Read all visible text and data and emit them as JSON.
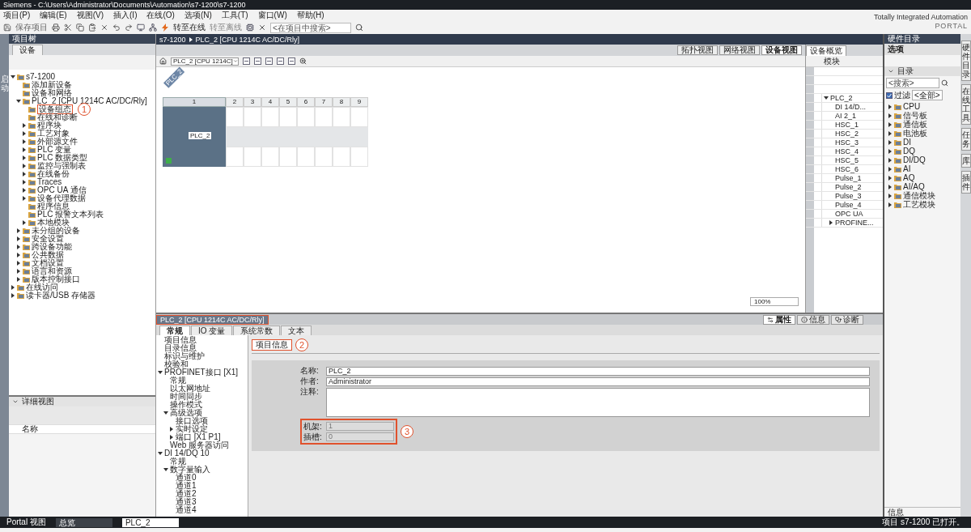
{
  "window": {
    "title": "Siemens - C:\\Users\\Administrator\\Documents\\Automation\\s7-1200\\s7-1200"
  },
  "brand": {
    "line1": "Totally Integrated Automation",
    "line2": "PORTAL"
  },
  "menu": [
    "项目(P)",
    "编辑(E)",
    "视图(V)",
    "插入(I)",
    "在线(O)",
    "选项(N)",
    "工具(T)",
    "窗口(W)",
    "帮助(H)"
  ],
  "toolbar": {
    "save": "保存项目",
    "go_online": "转至在线",
    "go_offline": "转至离线",
    "search": {
      "placeholder": "<在项目中搜索>"
    }
  },
  "side_strip": {
    "label": "启动"
  },
  "project_tree": {
    "title": "项目树",
    "tab": "设备",
    "items": [
      {
        "label": "s7-1200",
        "expanded": true,
        "children": [
          {
            "label": "添加新设备"
          },
          {
            "label": "设备和网络"
          },
          {
            "label": "PLC_2 [CPU 1214C AC/DC/Rly]",
            "expanded": true,
            "children": [
              {
                "label": "设备组态",
                "callout": "1"
              },
              {
                "label": "在线和诊断"
              },
              {
                "label": "程序块",
                "expanded": false
              },
              {
                "label": "工艺对象",
                "expanded": false
              },
              {
                "label": "外部源文件",
                "expanded": false
              },
              {
                "label": "PLC 变量",
                "expanded": false
              },
              {
                "label": "PLC 数据类型",
                "expanded": false
              },
              {
                "label": "监控与强制表",
                "expanded": false
              },
              {
                "label": "在线备份",
                "expanded": false
              },
              {
                "label": "Traces",
                "expanded": false
              },
              {
                "label": "OPC UA 通信",
                "expanded": false
              },
              {
                "label": "设备代理数据",
                "expanded": false
              },
              {
                "label": "程序信息"
              },
              {
                "label": "PLC 报警文本列表"
              },
              {
                "label": "本地模块",
                "expanded": false
              }
            ]
          },
          {
            "label": "未分组的设备",
            "expanded": false
          },
          {
            "label": "安全设置",
            "expanded": false
          },
          {
            "label": "跨设备功能",
            "expanded": false
          },
          {
            "label": "公共数据",
            "expanded": false
          },
          {
            "label": "文档设置",
            "expanded": false
          },
          {
            "label": "语言和资源",
            "expanded": false
          },
          {
            "label": "版本控制接口",
            "expanded": false
          }
        ]
      },
      {
        "label": "在线访问",
        "expanded": false
      },
      {
        "label": "读卡器/USB 存储器",
        "expanded": false
      }
    ]
  },
  "details_view": {
    "title": "详细视图",
    "column": "名称"
  },
  "editor": {
    "breadcrumb": [
      "s7-1200",
      "PLC_2 [CPU 1214C AC/DC/Rly]"
    ],
    "view_tabs": [
      {
        "label": "拓扑视图",
        "selected": false
      },
      {
        "label": "网络视图",
        "selected": false
      },
      {
        "label": "设备视图",
        "selected": true
      }
    ],
    "device_select": "PLC_2 [CPU 1214C]",
    "rack_label": "PLC_2",
    "slots": [
      "1",
      "2",
      "3",
      "4",
      "5",
      "6",
      "7",
      "8",
      "9"
    ],
    "cpu_label": "PLC_2",
    "zoom": "100%"
  },
  "device_overview": {
    "tab": "设备概览",
    "column": "模块",
    "rows": [
      {
        "module": "PLC_2",
        "expanded": true,
        "children": [
          {
            "module": "DI 14/D..."
          },
          {
            "module": "AI 2_1"
          },
          {
            "module": "HSC_1"
          },
          {
            "module": "HSC_2"
          },
          {
            "module": "HSC_3"
          },
          {
            "module": "HSC_4"
          },
          {
            "module": "HSC_5"
          },
          {
            "module": "HSC_6"
          },
          {
            "module": "Pulse_1"
          },
          {
            "module": "Pulse_2"
          },
          {
            "module": "Pulse_3"
          },
          {
            "module": "Pulse_4"
          },
          {
            "module": "OPC UA"
          },
          {
            "module": "PROFINE...",
            "expanded": false
          }
        ]
      }
    ]
  },
  "inspector": {
    "title": "PLC_2 [CPU 1214C AC/DC/Rly]",
    "title_marked": true,
    "tabs": [
      {
        "label": "常规",
        "selected": true
      },
      {
        "label": "IO 变量",
        "selected": false
      },
      {
        "label": "系统常数",
        "selected": false
      },
      {
        "label": "文本",
        "selected": false
      }
    ],
    "panel_tabs": [
      {
        "label": "属性",
        "selected": true
      },
      {
        "label": "信息",
        "selected": false
      },
      {
        "label": "诊断",
        "selected": false
      }
    ],
    "nav": [
      {
        "label": "项目信息"
      },
      {
        "label": "目录信息"
      },
      {
        "label": "标识与维护"
      },
      {
        "label": "校验和"
      },
      {
        "label": "PROFINET接口 [X1]",
        "expanded": true,
        "children": [
          {
            "label": "常规"
          },
          {
            "label": "以太网地址"
          },
          {
            "label": "时间同步"
          },
          {
            "label": "操作模式"
          },
          {
            "label": "高级选项",
            "expanded": true,
            "children": [
              {
                "label": "接口选项"
              },
              {
                "label": "实时设定",
                "expanded": false
              },
              {
                "label": "端口 [X1 P1]",
                "expanded": false
              }
            ]
          },
          {
            "label": "Web 服务器访问"
          }
        ]
      },
      {
        "label": "DI 14/DQ 10",
        "expanded": true,
        "children": [
          {
            "label": "常规"
          },
          {
            "label": "数字量输入",
            "expanded": true,
            "children": [
              {
                "label": "通道0"
              },
              {
                "label": "通道1"
              },
              {
                "label": "通道2"
              },
              {
                "label": "通道3"
              },
              {
                "label": "通道4"
              }
            ]
          }
        ]
      }
    ],
    "section": {
      "label": "项目信息",
      "callout": "2"
    },
    "fields": [
      {
        "kind": "text",
        "label": "名称:",
        "value": "PLC_2",
        "disabled": false
      },
      {
        "kind": "text",
        "label": "作者:",
        "value": "Administrator",
        "disabled": false
      },
      {
        "kind": "area",
        "label": "注释:",
        "disabled": false
      },
      {
        "kind": "readonly",
        "label": "机架:",
        "value": "1",
        "disabled": true
      },
      {
        "kind": "readonly",
        "label": "插槽:",
        "value": "0",
        "disabled": true
      }
    ],
    "readonly_callout": "3"
  },
  "catalog": {
    "title": "硬件目录",
    "options": "选项",
    "section": "目录",
    "search": {
      "placeholder": "<搜索>"
    },
    "filter": {
      "label": "过滤",
      "value": "<全部>",
      "checked": true
    },
    "items": [
      "CPU",
      "信号板",
      "通信板",
      "电池板",
      "DI",
      "DQ",
      "DI/DQ",
      "AI",
      "AQ",
      "AI/AQ",
      "通信模块",
      "工艺模块"
    ],
    "info": "信息"
  },
  "side_tabs": [
    "硬件目录",
    "在线工具",
    "任务",
    "库",
    "插件"
  ],
  "taskbar": {
    "portal": "Portal 视图",
    "items": [
      {
        "label": "总览",
        "selected": false
      },
      {
        "label": "PLC_2",
        "selected": true
      }
    ],
    "status": "项目 s7-1200 已打开。"
  }
}
